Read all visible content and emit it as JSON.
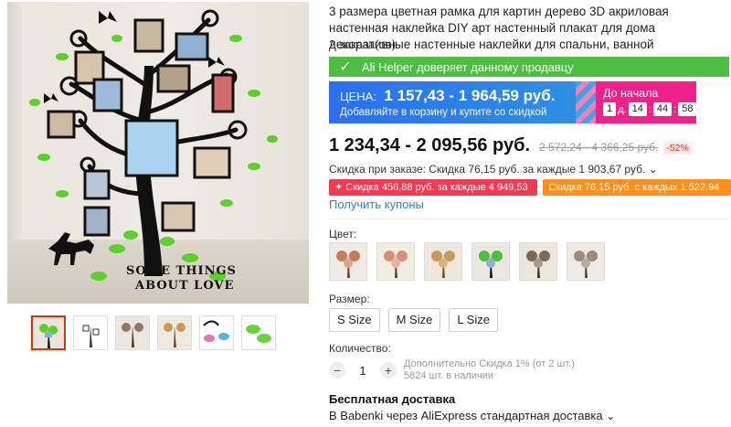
{
  "product": {
    "title": "3 размера цветная рамка для картин дерево 3D акриловая настенная наклейка DIY арт настенный плакат для дома декоративные настенные наклейки для спальни, ванной",
    "orders": "2 заказа(ов)"
  },
  "helper": {
    "text": "Ali Helper доверяет данному продавцу",
    "icon": "check-icon"
  },
  "promo": {
    "price_label": "ЦЕНА:",
    "price_range": "1 157,43 - 1 964,59 руб.",
    "subtitle": "Добавляйте в корзину и купите со скидкой",
    "countdown_label": "До начала",
    "days": "1",
    "days_unit": "д.",
    "hours": "14",
    "minutes": "44",
    "seconds": "58",
    "colors": {
      "blue": "#2b6ff0",
      "pink": "#f2208b"
    }
  },
  "price": {
    "current": "1 234,34 - 2 095,56 руб.",
    "old": "2 572,24 - 4 366,25 руб.",
    "discount": "-52%"
  },
  "order_discount": "Скидка при заказе: Скидка 76,15 руб. за каждые 1 903,67 руб.",
  "coupons": [
    {
      "text": "Скидка 456,88 руб. за каждые 4 949,53 руб.",
      "color": "#f23a53"
    },
    {
      "text": "Скидка 76,15 руб. с каждых 1 522,94 руб.",
      "color": "#fd8f1c"
    }
  ],
  "get_coupons": "Получить купоны",
  "color_label": "Цвет:",
  "color_options": [
    "variant-1",
    "variant-2",
    "variant-3",
    "variant-4",
    "variant-5",
    "variant-6"
  ],
  "size_label": "Размер:",
  "sizes": [
    "S Size",
    "M Size",
    "L Size"
  ],
  "quantity": {
    "label": "Количество:",
    "value": "1",
    "minus": "−",
    "plus": "+",
    "extra_discount": "Дополнительно Скидка 1% (от 2 шт.)",
    "stock": "5824 шт. в наличии"
  },
  "shipping": {
    "title": "Бесплатная доставка",
    "line": "В Babenki через AliExpress стандартная доставка"
  },
  "gallery": {
    "wall_text_1": "SOME THINGS",
    "wall_text_2": "ABOUT LOVE",
    "thumb_count": 6
  }
}
